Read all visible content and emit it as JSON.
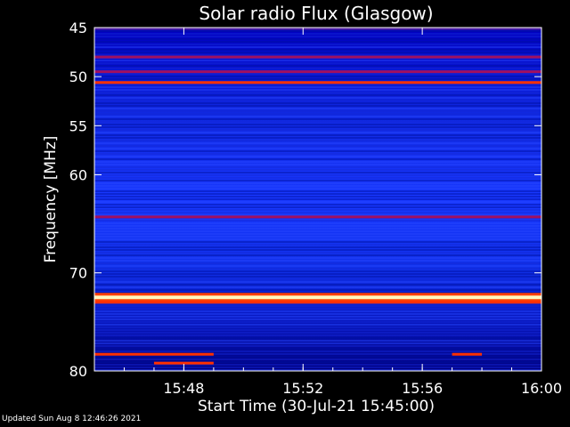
{
  "chart_data": {
    "type": "heatmap",
    "title": "Solar radio Flux (Glasgow)",
    "xlabel": "Start Time (30-Jul-21 15:45:00)",
    "ylabel": "Frequency [MHz]",
    "x_axis": {
      "unit": "time",
      "range": [
        "15:45:00",
        "16:00:00"
      ],
      "ticks": [
        "15:48",
        "15:52",
        "15:56",
        "16:00"
      ]
    },
    "y_axis": {
      "unit": "MHz",
      "range": [
        45,
        80
      ],
      "inverted": true,
      "ticks": [
        45,
        50,
        55,
        60,
        70,
        80
      ]
    },
    "colormap": [
      "#0000a0",
      "#2030ff",
      "#a01060",
      "#ff3000",
      "#ffd000",
      "#ffffff"
    ],
    "features": [
      {
        "freq_mhz": 45.1,
        "intensity": "medium"
      },
      {
        "freq_mhz": 48.0,
        "intensity": "medium-high"
      },
      {
        "freq_mhz": 49.5,
        "intensity": "medium-high"
      },
      {
        "freq_mhz": 50.6,
        "intensity": "high"
      },
      {
        "freq_mhz": 64.3,
        "intensity": "medium-high"
      },
      {
        "freq_mhz": 72.5,
        "intensity": "very high"
      },
      {
        "freq_mhz": 73.0,
        "intensity": "high"
      },
      {
        "freq_mhz": 78.3,
        "intensity": "high",
        "time_range": [
          "15:45",
          "15:49"
        ]
      },
      {
        "freq_mhz": 79.2,
        "intensity": "high",
        "time_range": [
          "15:47",
          "15:49"
        ]
      },
      {
        "freq_mhz": 78.3,
        "intensity": "high",
        "time_range": [
          "15:57",
          "15:58"
        ]
      }
    ]
  },
  "footer": {
    "updated": "Updated Sun Aug  8 12:46:26 2021"
  }
}
